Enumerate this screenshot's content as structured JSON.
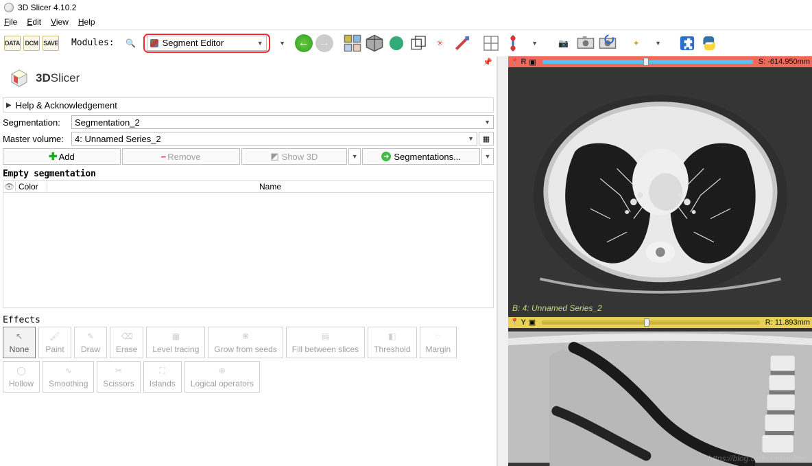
{
  "app": {
    "title": "3D Slicer 4.10.2"
  },
  "menu": {
    "file": "File",
    "edit": "Edit",
    "view": "View",
    "help": "Help"
  },
  "toolbar": {
    "data": "DATA",
    "dcm": "DCM",
    "save": "SAVE",
    "modules_label": "Modules:",
    "module": "Segment Editor"
  },
  "module_panel": {
    "title_a": "3D",
    "title_b": "Slicer",
    "help": "Help & Acknowledgement",
    "seg_label": "Segmentation:",
    "seg_value": "Segmentation_2",
    "vol_label": "Master volume:",
    "vol_value": "4: Unnamed Series_2",
    "btn_add": "Add",
    "btn_remove": "Remove",
    "btn_show3d": "Show 3D",
    "btn_segs": "Segmentations...",
    "empty": "Empty segmentation",
    "col_color": "Color",
    "col_name": "Name",
    "effects": "Effects"
  },
  "fx": {
    "none": "None",
    "paint": "Paint",
    "draw": "Draw",
    "erase": "Erase",
    "level": "Level tracing",
    "grow": "Grow from seeds",
    "fill": "Fill between slices",
    "thresh": "Threshold",
    "margin": "Margin",
    "hollow": "Hollow",
    "smooth": "Smoothing",
    "scissors": "Scissors",
    "islands": "Islands",
    "logical": "Logical operators"
  },
  "views": {
    "red": {
      "letter": "R",
      "readout": "S: -614.950mm",
      "thumb_left": "48%"
    },
    "red_overlay": "B: 4: Unnamed Series_2",
    "yellow": {
      "letter": "Y",
      "readout": "R: 11.893mm",
      "thumb_left": "47%"
    }
  }
}
